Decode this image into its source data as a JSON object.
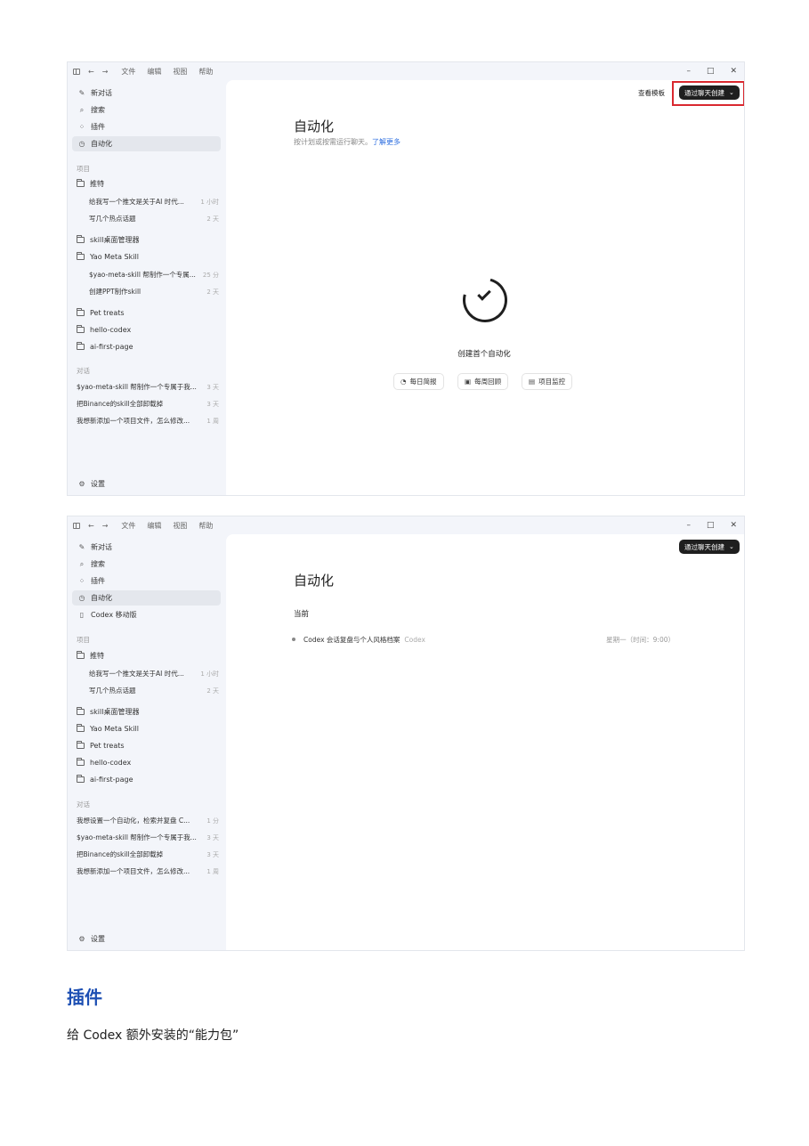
{
  "titlebar": {
    "menu": [
      "文件",
      "编辑",
      "视图",
      "帮助"
    ],
    "nav_back": "←",
    "nav_forward": "→",
    "min": "–",
    "max": "□",
    "close": "✕"
  },
  "screenshot1": {
    "sidebar": {
      "top_items": [
        {
          "icon": "✎",
          "label": "新对话"
        },
        {
          "icon": "⌕",
          "label": "搜索"
        },
        {
          "icon": "⁘",
          "label": "插件"
        },
        {
          "icon": "◷",
          "label": "自动化"
        }
      ],
      "projects_label": "项目",
      "projects": [
        {
          "label": "推特",
          "children": [
            {
              "label": "给我写一个推文是关于AI 时代...",
              "time": "1 小时"
            },
            {
              "label": "写几个热点话题",
              "time": "2 天"
            }
          ]
        },
        {
          "label": "skill桌面管理器",
          "children": []
        },
        {
          "label": "Yao Meta Skill",
          "children": [
            {
              "label": "$yao-meta-skill 帮制作一个专属...",
              "time": "25 分"
            },
            {
              "label": "创建PPT制作skill",
              "time": "2 天"
            }
          ]
        },
        {
          "label": "Pet treats",
          "children": []
        },
        {
          "label": "hello-codex",
          "children": []
        },
        {
          "label": "ai-first-page",
          "children": []
        }
      ],
      "conversations_label": "对话",
      "conversations": [
        {
          "label": "$yao-meta-skill 帮制作一个专属于我...",
          "time": "3 天"
        },
        {
          "label": "把Binance的skill全部卸载掉",
          "time": "3 天"
        },
        {
          "label": "我想新添加一个项目文件，怎么修改...",
          "time": "1 周"
        }
      ],
      "settings": "设置"
    },
    "main": {
      "view_templates": "查看模板",
      "create_via_chat": "通过聊天创建",
      "title": "自动化",
      "subtitle": "按计划或按需运行聊天。",
      "learn_more": "了解更多",
      "empty_title": "创建首个自动化",
      "chips": [
        {
          "icon": "◔",
          "label": "每日简报"
        },
        {
          "icon": "▣",
          "label": "每周回顾"
        },
        {
          "icon": "▤",
          "label": "项目监控"
        }
      ]
    }
  },
  "screenshot2": {
    "sidebar": {
      "top_items": [
        {
          "icon": "✎",
          "label": "新对话"
        },
        {
          "icon": "⌕",
          "label": "搜索"
        },
        {
          "icon": "⁘",
          "label": "插件"
        },
        {
          "icon": "◷",
          "label": "自动化"
        },
        {
          "icon": "▯",
          "label": "Codex 移动版"
        }
      ],
      "projects_label": "项目",
      "projects": [
        {
          "label": "推特",
          "children": [
            {
              "label": "给我写一个推文是关于AI 时代...",
              "time": "1 小时"
            },
            {
              "label": "写几个热点话题",
              "time": "2 天"
            }
          ]
        },
        {
          "label": "skill桌面管理器",
          "children": []
        },
        {
          "label": "Yao Meta Skill",
          "children": []
        },
        {
          "label": "Pet treats",
          "children": []
        },
        {
          "label": "hello-codex",
          "children": []
        },
        {
          "label": "ai-first-page",
          "children": []
        }
      ],
      "conversations_label": "对话",
      "conversations": [
        {
          "label": "我想设置一个自动化，检索并复盘 C...",
          "time": "1 分"
        },
        {
          "label": "$yao-meta-skill 帮制作一个专属于我...",
          "time": "3 天"
        },
        {
          "label": "把Binance的skill全部卸载掉",
          "time": "3 天"
        },
        {
          "label": "我想新添加一个项目文件，怎么修改...",
          "time": "1 周"
        }
      ],
      "settings": "设置"
    },
    "main": {
      "create_via_chat": "通过聊天创建",
      "title": "自动化",
      "current_label": "当前",
      "automations": [
        {
          "name": "Codex 会话复盘与个人风格档案",
          "source": "Codex",
          "schedule": "星期一（时间：9:00）"
        }
      ]
    }
  },
  "doc": {
    "heading": "插件",
    "body": "给 Codex 额外安装的“能力包”"
  }
}
